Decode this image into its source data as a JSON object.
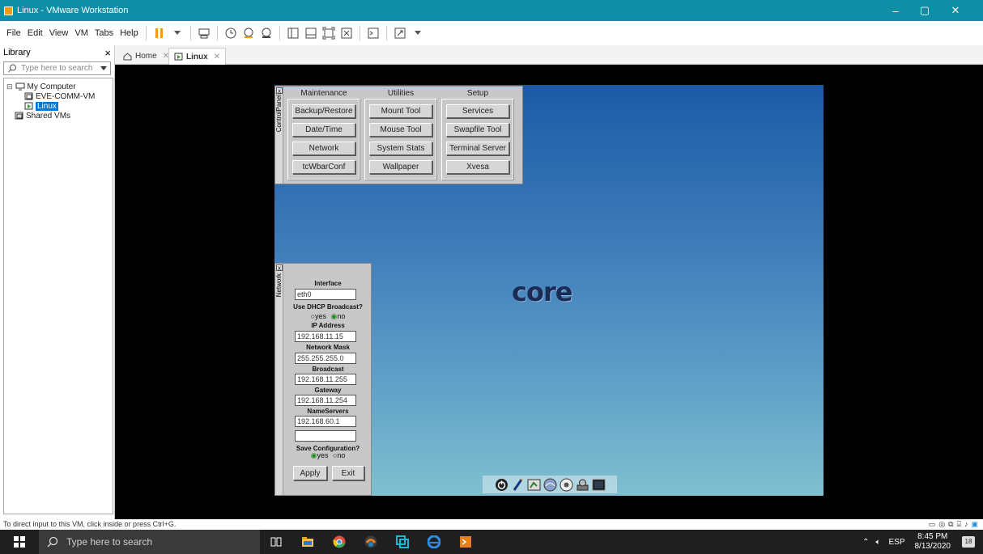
{
  "window": {
    "title": "Linux - VMware Workstation",
    "minimize": "–",
    "maximize": "▢",
    "close": "✕"
  },
  "menu": {
    "items": [
      "File",
      "Edit",
      "View",
      "VM",
      "Tabs",
      "Help"
    ]
  },
  "library": {
    "title": "Library",
    "close": "×",
    "search_placeholder": "Type here to search",
    "tree": {
      "root": "My Computer",
      "vm1": "EVE-COMM-VM",
      "vm2": "Linux",
      "shared": "Shared VMs"
    }
  },
  "tabs": [
    {
      "label": "Home"
    },
    {
      "label": "Linux"
    }
  ],
  "control_panel": {
    "title": "ControlPanel",
    "columns": [
      {
        "header": "Maintenance",
        "buttons": [
          "Backup/Restore",
          "Date/Time",
          "Network",
          "tcWbarConf"
        ]
      },
      {
        "header": "Utilities",
        "buttons": [
          "Mount Tool",
          "Mouse Tool",
          "System Stats",
          "Wallpaper"
        ]
      },
      {
        "header": "Setup",
        "buttons": [
          "Services",
          "Swapfile Tool",
          "Terminal Server",
          "Xvesa"
        ]
      }
    ]
  },
  "network": {
    "title": "Network",
    "interface_label": "Interface",
    "interface": "eth0",
    "dhcp_label": "Use DHCP Broadcast?",
    "dhcp_yes": "yes",
    "dhcp_no": "no",
    "ip_label": "IP Address",
    "ip": "192.168.11.15",
    "mask_label": "Network Mask",
    "mask": "255.255.255.0",
    "broadcast_label": "Broadcast",
    "broadcast": "192.168.11.255",
    "gateway_label": "Gateway",
    "gateway": "192.168.11.254",
    "ns_label": "NameServers",
    "ns1": "192.168.60.1",
    "ns2": "",
    "save_label": "Save Configuration?",
    "save_yes": "yes",
    "save_no": "no",
    "apply": "Apply",
    "exit": "Exit"
  },
  "logo": "core",
  "status": {
    "text": "To direct input to this VM, click inside or press Ctrl+G."
  },
  "taskbar": {
    "search_placeholder": "Type here to search",
    "lang": "ESP",
    "time": "8:45 PM",
    "date": "8/13/2020",
    "notifications": "18"
  },
  "colors": {
    "titlebar": "#0f8fa5",
    "selection": "#0078d7",
    "taskbar": "#1f1f1f"
  }
}
